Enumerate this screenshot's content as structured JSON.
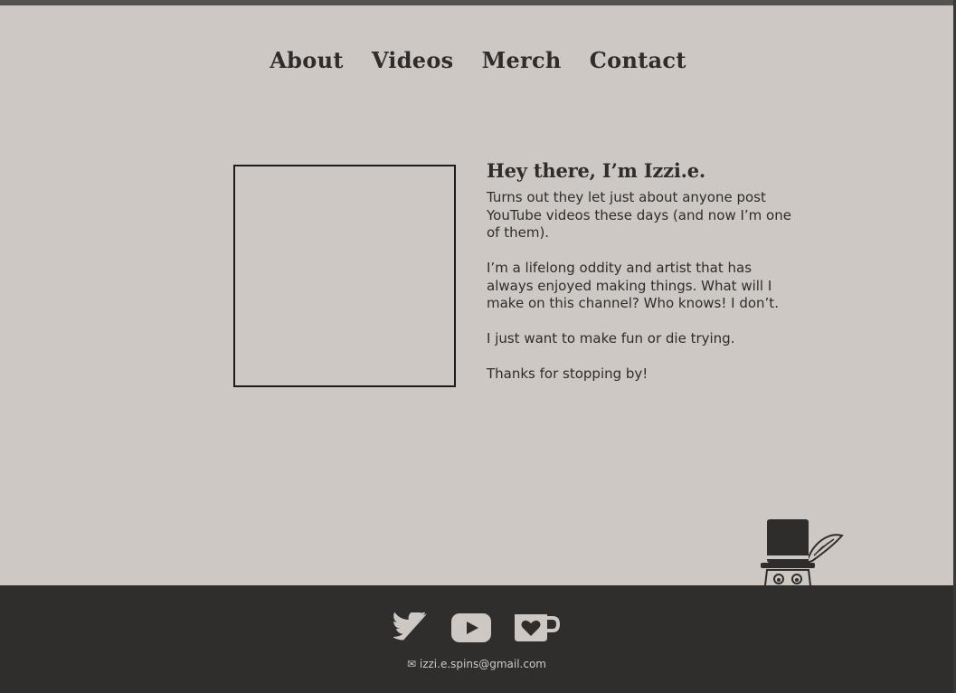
{
  "nav": {
    "items": [
      {
        "label": "About"
      },
      {
        "label": "Videos"
      },
      {
        "label": "Merch"
      },
      {
        "label": "Contact"
      }
    ]
  },
  "bio": {
    "heading": "Hey there, I’m Izzi.e.",
    "paragraphs": [
      "Turns out they let just about anyone post YouTube videos these days (and now I’m one of them).",
      "I’m a lifelong oddity and artist that has always enjoyed making things. What will I make on this channel? Who knows! I don’t.",
      "I just want to make fun or die trying.",
      "Thanks for stopping by!"
    ]
  },
  "footer": {
    "social_icons": [
      "twitter-icon",
      "youtube-icon",
      "ko-fi-icon"
    ],
    "email": "✉ izzi.e.spins@gmail.com"
  },
  "colors": {
    "background": "#cdc8c3",
    "text": "#2f2d2c",
    "footer": "#302e2c"
  }
}
